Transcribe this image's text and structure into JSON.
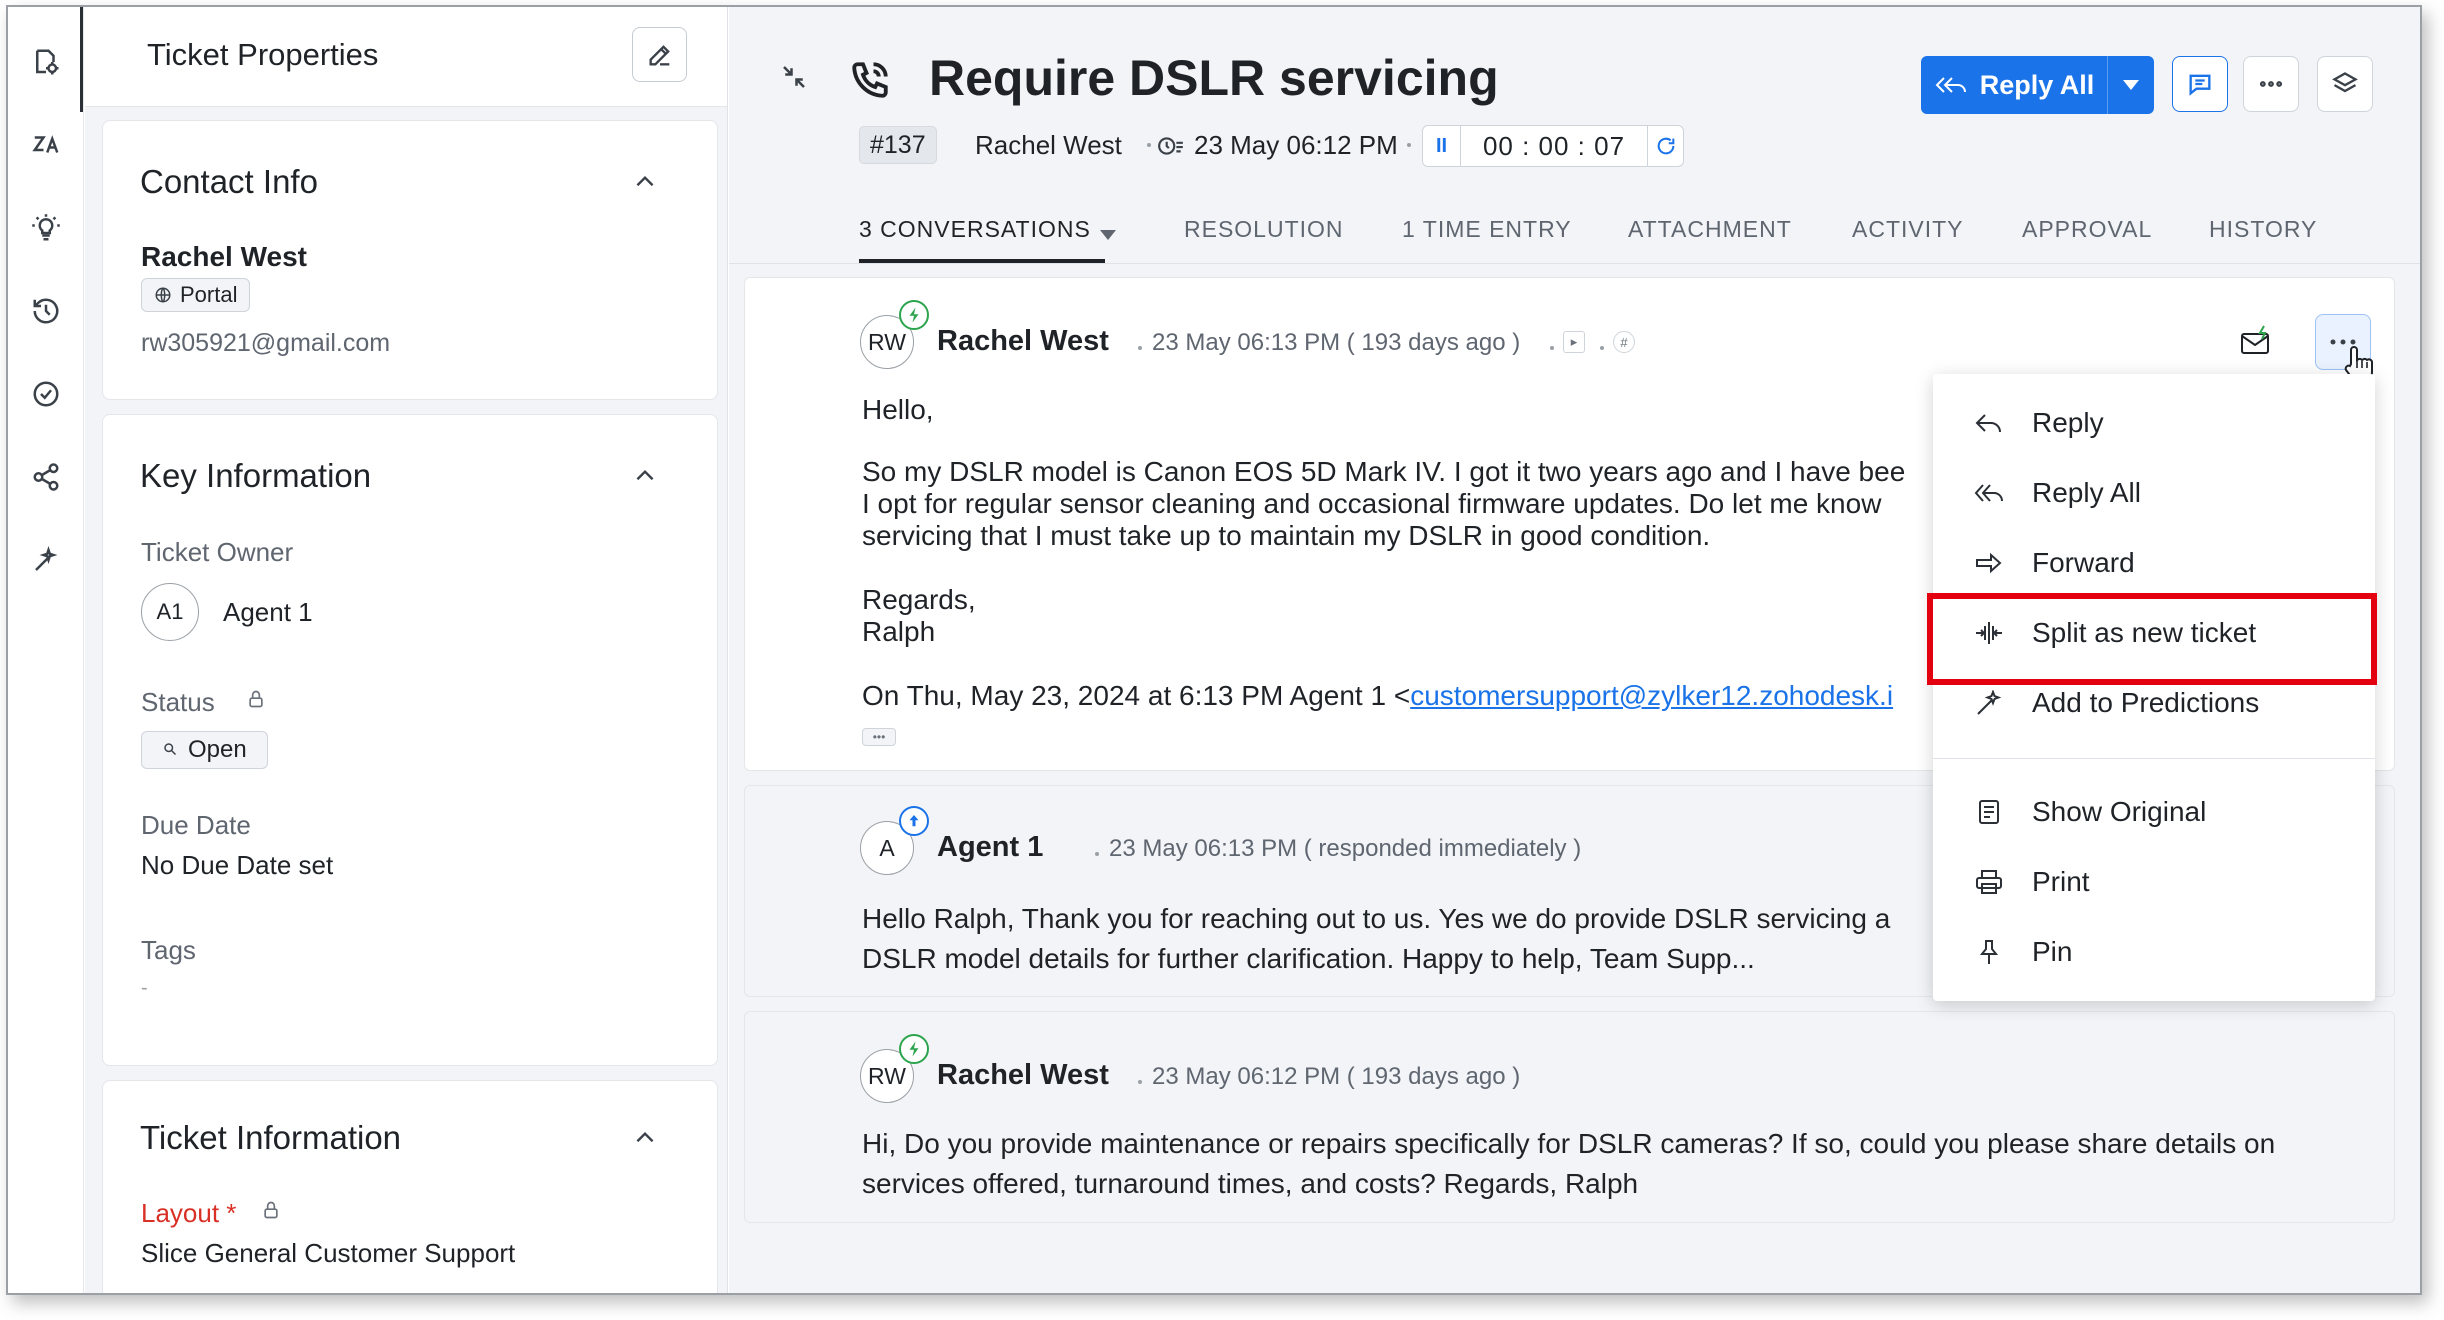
{
  "rail": {
    "items": [
      "ticket-settings-icon",
      "translate-icon",
      "lightbulb-icon",
      "history-icon",
      "check-circle-icon",
      "share-icon",
      "magic-wand-icon"
    ]
  },
  "properties": {
    "title": "Ticket Properties",
    "contact": {
      "heading": "Contact Info",
      "name": "Rachel West",
      "channel": "Portal",
      "email": "rw305921@gmail.com"
    },
    "key_info": {
      "heading": "Key Information",
      "owner_label": "Ticket Owner",
      "owner_initials": "A1",
      "owner_name": "Agent 1",
      "status_label": "Status",
      "status_value": "Open",
      "due_label": "Due Date",
      "due_value": "No Due Date set",
      "tags_label": "Tags",
      "tags_value": "-"
    },
    "ticket_info": {
      "heading": "Ticket Information",
      "layout_label": "Layout *",
      "layout_value": "Slice General Customer Support"
    }
  },
  "ticket": {
    "title": "Require DSLR servicing",
    "id": "#137",
    "contact": "Rachel West",
    "created": "23 May 06:12 PM",
    "timer": "00 : 00 : 07",
    "reply_all_label": "Reply All"
  },
  "tabs": [
    {
      "label": "3 CONVERSATIONS",
      "active": true
    },
    {
      "label": "RESOLUTION"
    },
    {
      "label": "1 TIME ENTRY"
    },
    {
      "label": "ATTACHMENT"
    },
    {
      "label": "ACTIVITY"
    },
    {
      "label": "APPROVAL"
    },
    {
      "label": "HISTORY"
    }
  ],
  "conversations": [
    {
      "initials": "RW",
      "sender": "Rachel West",
      "time": "23 May 06:13 PM ( 193 days ago )",
      "body": [
        "Hello,",
        "So my DSLR model is Canon EOS 5D Mark IV. I got it two years ago and I have bee",
        "I opt for regular sensor cleaning and occasional firmware updates. Do let me know",
        "servicing that I must take up to maintain my DSLR in good condition.",
        "Regards,",
        "Ralph",
        "On Thu, May 23, 2024 at 6:13 PM Agent 1 <",
        "customersupport@zylker12.zohodesk.i"
      ]
    },
    {
      "initials": "A",
      "sender": "Agent 1",
      "time": "23 May 06:13 PM ( responded immediately )",
      "body": [
        "Hello Ralph, Thank you for reaching out to us. Yes we do provide DSLR servicing a",
        "DSLR model details for further clarification. Happy to help, Team Supp..."
      ]
    },
    {
      "initials": "RW",
      "sender": "Rachel West",
      "time": "23 May 06:12 PM ( 193 days ago )",
      "body": [
        "Hi, Do you provide maintenance or repairs specifically for DSLR cameras? If so, could you please share details on",
        "services offered, turnaround times, and costs? Regards, Ralph"
      ]
    }
  ],
  "menu": {
    "items": [
      {
        "label": "Reply",
        "icon": "reply-icon"
      },
      {
        "label": "Reply All",
        "icon": "reply-all-icon"
      },
      {
        "label": "Forward",
        "icon": "forward-icon"
      },
      {
        "label": "Split as new ticket",
        "icon": "split-icon"
      },
      {
        "label": "Add to Predictions",
        "icon": "magic-wand-icon"
      },
      {
        "label": "Show Original",
        "icon": "show-original-icon"
      },
      {
        "label": "Print",
        "icon": "print-icon"
      },
      {
        "label": "Pin",
        "icon": "pin-icon"
      }
    ]
  },
  "colors": {
    "accent": "#1a73e8",
    "highlight": "#e3000f",
    "badge_green": "#2da44e"
  }
}
